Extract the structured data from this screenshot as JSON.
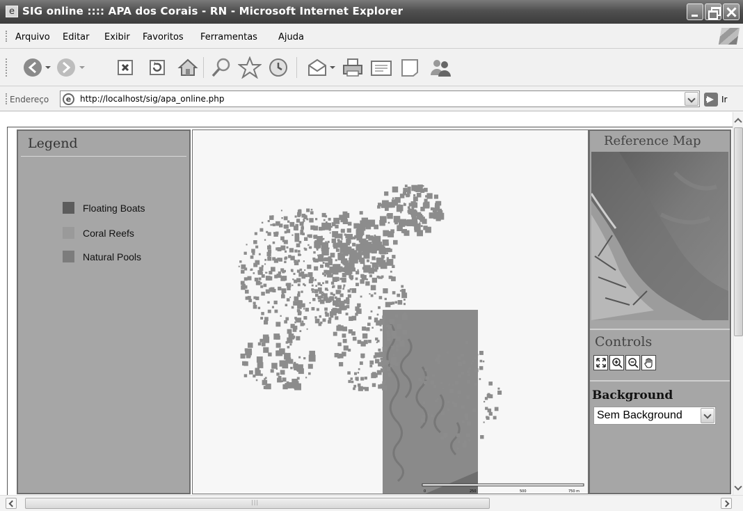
{
  "window": {
    "title": "SIG online :::: APA dos Corais - RN - Microsoft Internet Explorer"
  },
  "menu": {
    "items": [
      "Arquivo",
      "Editar",
      "Exibir",
      "Favoritos",
      "Ferramentas",
      "Ajuda"
    ]
  },
  "toolbar": {
    "buttons": [
      "back-icon",
      "forward-icon",
      "stop-icon",
      "refresh-icon",
      "home-icon",
      "search-icon",
      "favorites-icon",
      "history-icon",
      "mail-icon",
      "print-icon",
      "edit-icon",
      "discuss-icon",
      "messenger-icon"
    ]
  },
  "address": {
    "label": "Endereço",
    "url": "http://localhost/sig/apa_online.php",
    "go_label": "Ir"
  },
  "legend": {
    "title": "Legend",
    "items": [
      {
        "label": "Floating Boats",
        "color": "#5c5c5c"
      },
      {
        "label": "Coral Reefs",
        "color": "#9a9a9a"
      },
      {
        "label": "Natural Pools",
        "color": "#7c7c7c"
      }
    ]
  },
  "map": {
    "colors": {
      "reef": "#8c8c8c",
      "area": "#8a8a8a",
      "pool_outline": "#777777",
      "background": "#f7f7f7"
    },
    "scale_labels": [
      "0",
      "250",
      "500",
      "750 m"
    ]
  },
  "reference_map": {
    "title": "Reference Map"
  },
  "controls": {
    "title": "Controls",
    "buttons": [
      "full-extent-icon",
      "zoom-in-icon",
      "zoom-out-icon",
      "pan-hand-icon"
    ]
  },
  "background": {
    "label": "Background",
    "selected": "Sem Background"
  }
}
